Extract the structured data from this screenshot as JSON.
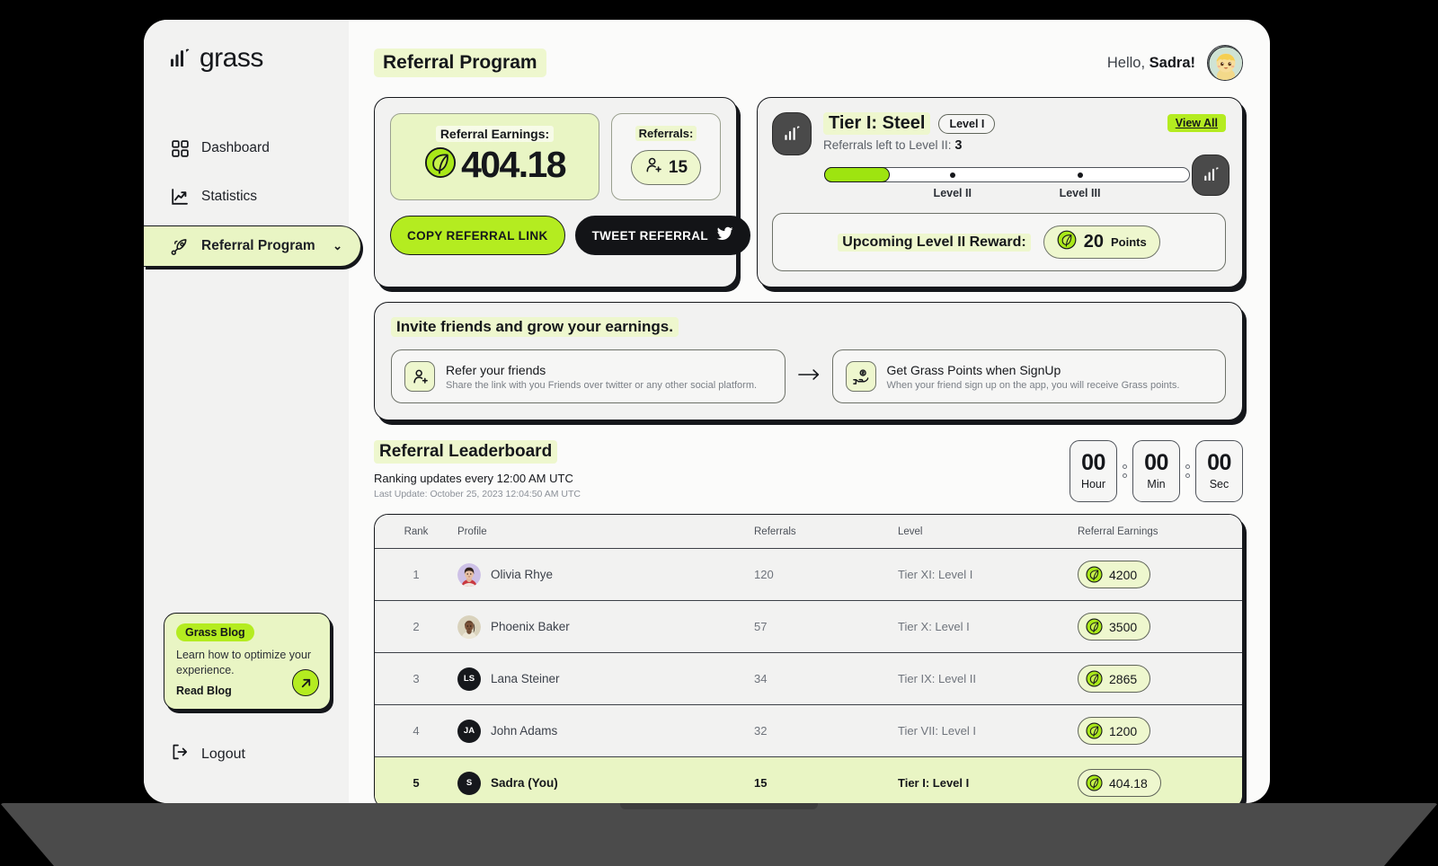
{
  "brand": {
    "name": "grass",
    "logo_icon": "grass-bars-icon"
  },
  "sidebar": {
    "items": [
      {
        "label": "Dashboard",
        "icon": "grid-icon",
        "active": false
      },
      {
        "label": "Statistics",
        "icon": "chart-line-icon",
        "active": false
      },
      {
        "label": "Referral Program",
        "icon": "rocket-icon",
        "active": true,
        "chevron": "chevron-down-icon"
      }
    ],
    "blog_card": {
      "badge": "Grass Blog",
      "description": "Learn how to optimize your experience.",
      "link": "Read Blog",
      "arrow_icon": "arrow-up-right-icon"
    },
    "logout": {
      "label": "Logout",
      "icon": "logout-icon"
    }
  },
  "header": {
    "page_title": "Referral Program",
    "greeting_prefix": "Hello,",
    "greeting_name": "Sadra!",
    "avatar_name": "user-avatar"
  },
  "earnings_card": {
    "earnings_label": "Referral Earnings:",
    "earnings_value": "404.18",
    "earnings_icon": "leaf-icon",
    "referrals_label": "Referrals:",
    "referrals_value": "15",
    "referrals_icon": "user-plus-icon",
    "copy_button": "COPY REFERRAL LINK",
    "tweet_button": "TWEET REFERRAL",
    "tweet_icon": "twitter-bird-icon"
  },
  "tier_card": {
    "tier_title": "Tier I: Steel",
    "tier_level_pill": "Level I",
    "view_all": "View All",
    "referrals_left_label": "Referrals left to Level II:",
    "referrals_left_value": "3",
    "tier_icon": "grass-bars-icon",
    "end_icon": "grass-bars-icon",
    "progress_percent": 18,
    "milestones": [
      {
        "label": "Level II",
        "position_percent": 35
      },
      {
        "label": "Level III",
        "position_percent": 70
      }
    ],
    "reward_label": "Upcoming Level II Reward:",
    "reward_value": "20",
    "reward_unit": "Points",
    "reward_icon": "leaf-icon"
  },
  "invite": {
    "title": "Invite friends and grow your earnings.",
    "arrow_icon": "arrow-right-icon",
    "steps": [
      {
        "icon": "user-plus-icon",
        "heading": "Refer your friends",
        "text": "Share the link with you Friends over twitter or any other social platform."
      },
      {
        "icon": "hand-coin-icon",
        "heading": "Get Grass Points when SignUp",
        "text": "When your friend sign up on the app, you will receive Grass points."
      }
    ]
  },
  "leaderboard": {
    "title": "Referral Leaderboard",
    "subtitle": "Ranking updates every 12:00 AM UTC",
    "last_update": "Last Update: October 25, 2023 12:04:50 AM UTC",
    "timer": [
      {
        "value": "00",
        "unit": "Hour"
      },
      {
        "value": "00",
        "unit": "Min"
      },
      {
        "value": "00",
        "unit": "Sec"
      }
    ],
    "columns": [
      "Rank",
      "Profile",
      "Referrals",
      "Level",
      "Referral Earnings"
    ],
    "rows": [
      {
        "rank": "1",
        "name": "Olivia Rhye",
        "avatar_type": "photo",
        "avatar_name": "avatar-olivia-rhye",
        "referrals": "120",
        "level": "Tier XI: Level I",
        "earnings": "4200"
      },
      {
        "rank": "2",
        "name": "Phoenix Baker",
        "avatar_type": "photo",
        "avatar_name": "avatar-phoenix-baker",
        "referrals": "57",
        "level": "Tier X: Level I",
        "earnings": "3500"
      },
      {
        "rank": "3",
        "name": "Lana Steiner",
        "avatar_type": "initials",
        "initials": "LS",
        "referrals": "34",
        "level": "Tier IX: Level II",
        "earnings": "2865"
      },
      {
        "rank": "4",
        "name": "John Adams",
        "avatar_type": "initials",
        "initials": "JA",
        "referrals": "32",
        "level": "Tier VII: Level I",
        "earnings": "1200"
      },
      {
        "rank": "5",
        "name": "Sadra (You)",
        "avatar_type": "initials",
        "initials": "S",
        "referrals": "15",
        "level": "Tier I: Level I",
        "earnings": "404.18"
      }
    ]
  },
  "colors": {
    "accent_green": "#b4ec20",
    "pale_green": "#e9f5c4",
    "highlight_green": "#eef7ce",
    "ink": "#15171b",
    "panel": "#f2f2f1",
    "screen_bg": "#fbfbfa"
  }
}
